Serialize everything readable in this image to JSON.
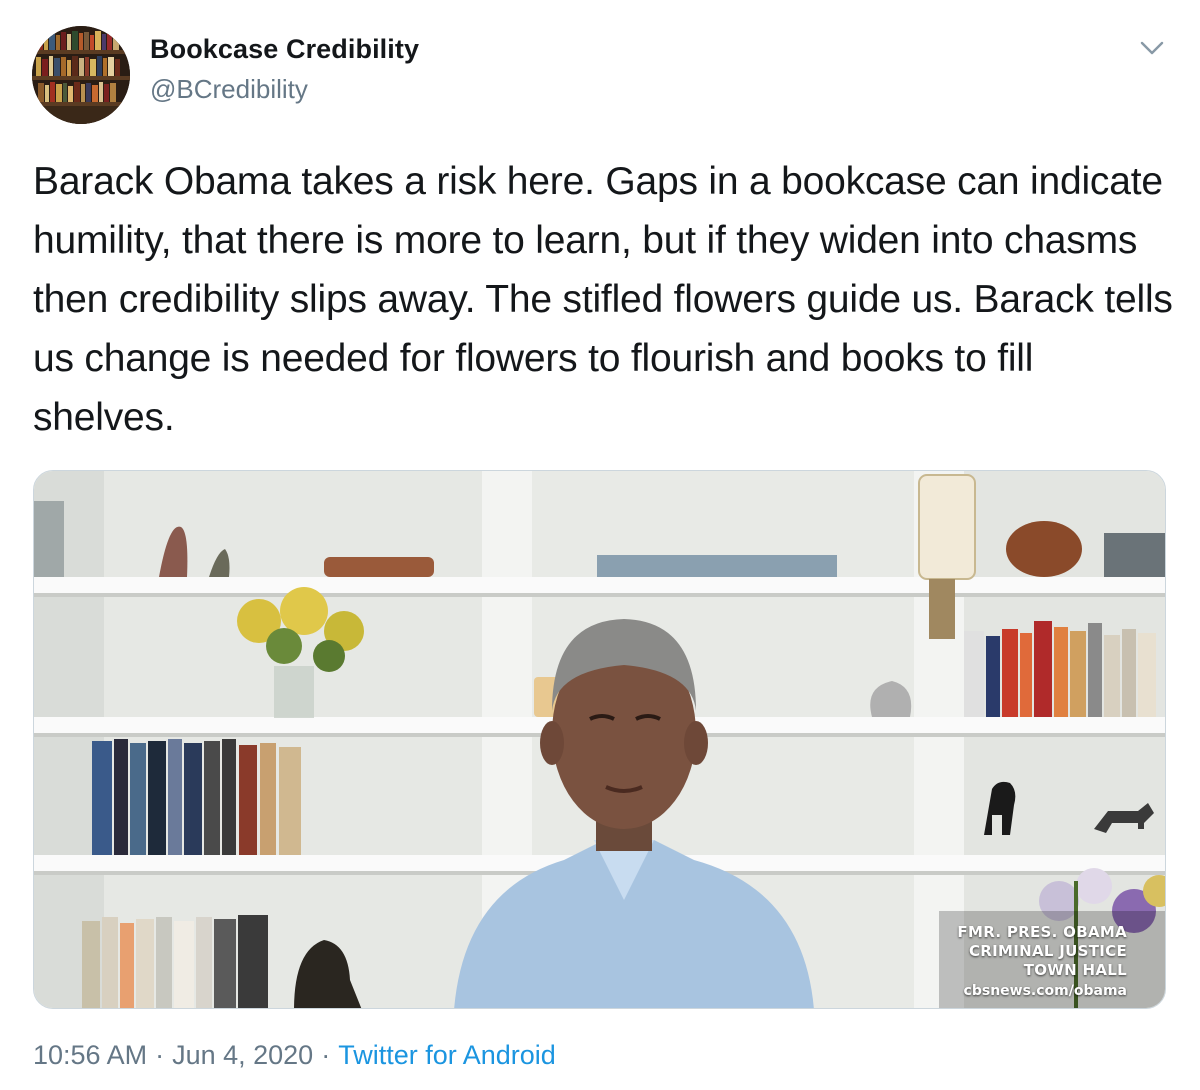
{
  "author": {
    "display_name": "Bookcase Credibility",
    "handle": "@BCredibility",
    "avatar_icon": "bookshelf-avatar"
  },
  "tweet": {
    "text": "Barack Obama takes a risk here. Gaps in a bookcase can indicate humility, that there is more to learn, but if they widen into chasms then credibility slips away. The stifled flowers guide us. Barack tells us change is needed for flowers to flourish and books to fill shelves."
  },
  "media": {
    "lower_third_lines": [
      "FMR. PRES. OBAMA",
      "CRIMINAL JUSTICE",
      "TOWN HALL"
    ],
    "lower_third_url": "cbsnews.com/obama"
  },
  "footer": {
    "time": "10:56 AM",
    "separator": "·",
    "date": "Jun 4, 2020",
    "source": "Twitter for Android"
  },
  "menu": {
    "caret_icon": "chevron-down-icon"
  },
  "colors": {
    "text": "#14171a",
    "secondary": "#657786",
    "link": "#1b95e0",
    "border": "#ccd6dd"
  }
}
